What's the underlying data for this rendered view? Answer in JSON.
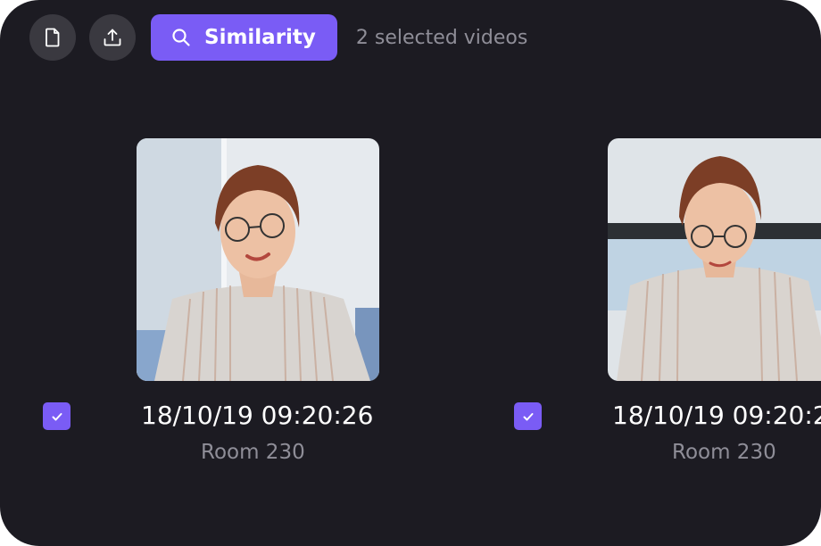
{
  "toolbar": {
    "file_icon": "file-icon",
    "upload_icon": "upload-icon",
    "similarity_label": "Similarity",
    "selection_status": "2 selected videos"
  },
  "colors": {
    "background": "#1c1b22",
    "accent": "#7a5cf5",
    "muted_text": "#8f8e98",
    "icon_button_bg": "#3a3940"
  },
  "videos": [
    {
      "timestamp": "18/10/19 09:20:26",
      "room": "Room 230",
      "selected": true
    },
    {
      "timestamp": "18/10/19 09:20:2",
      "room": "Room 230",
      "selected": true
    }
  ]
}
